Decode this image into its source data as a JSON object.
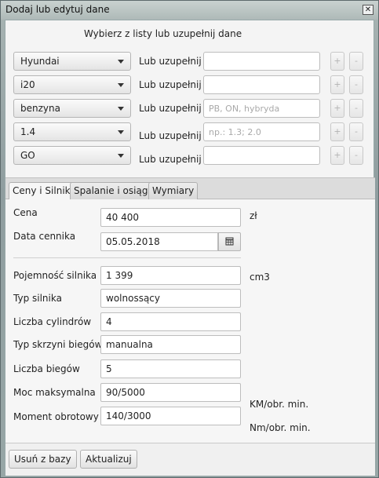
{
  "window": {
    "title": "Dodaj lub edytuj dane"
  },
  "header": {
    "label": "Wybierz z listy lub uzupełnij dane"
  },
  "rows": [
    {
      "combo": "Hyundai",
      "lub": "Lub uzupełnij",
      "input_value": "",
      "placeholder": "",
      "plus": "+",
      "minus": "-"
    },
    {
      "combo": "i20",
      "lub": "Lub uzupełnij",
      "input_value": "",
      "placeholder": "",
      "plus": "+",
      "minus": "-"
    },
    {
      "combo": "benzyna",
      "lub": "Lub uzupełnij",
      "input_value": "",
      "placeholder": "PB, ON, hybryda",
      "plus": "+",
      "minus": "-"
    },
    {
      "combo": "1.4",
      "lub": "Lub uzupełnij",
      "input_value": "",
      "placeholder": "np.: 1.3; 2.0",
      "plus": "+",
      "minus": "-"
    },
    {
      "combo": "GO",
      "lub": "Lub uzupełnij",
      "input_value": "",
      "placeholder": "",
      "plus": "+",
      "minus": "-"
    }
  ],
  "tabs": [
    {
      "label": "Ceny i Silnik",
      "active": true
    },
    {
      "label": "Spalanie i osiągi",
      "active": false
    },
    {
      "label": "Wymiary",
      "active": false
    }
  ],
  "fields": {
    "cena": {
      "label": "Cena",
      "value": "40 400",
      "unit": "zł"
    },
    "data_cennika": {
      "label": "Data cennika",
      "value": "05.05.2018"
    },
    "pojemnosc": {
      "label": "Pojemność silnika",
      "value": "1 399",
      "unit": "cm3"
    },
    "typ_silnika": {
      "label": "Typ silnika",
      "value": "wolnossący"
    },
    "liczba_cylindrow": {
      "label": "Liczba cylindrów",
      "value": "4"
    },
    "typ_skrzyni": {
      "label": "Typ skrzyni biegów",
      "value": "manualna"
    },
    "liczba_biegow": {
      "label": "Liczba biegów",
      "value": "5"
    },
    "moc": {
      "label": "Moc maksymalna",
      "value": "90/5000",
      "unit": "KM/obr. min."
    },
    "moment": {
      "label": "Moment obrotowy",
      "value": "140/3000",
      "unit": "Nm/obr. min."
    }
  },
  "footer": {
    "delete_label": "Usuń z bazy",
    "update_label": "Aktualizuj"
  },
  "icons": {
    "close": "close-icon",
    "calendar": "calendar-icon",
    "dropdown": "chevron-down-icon"
  }
}
